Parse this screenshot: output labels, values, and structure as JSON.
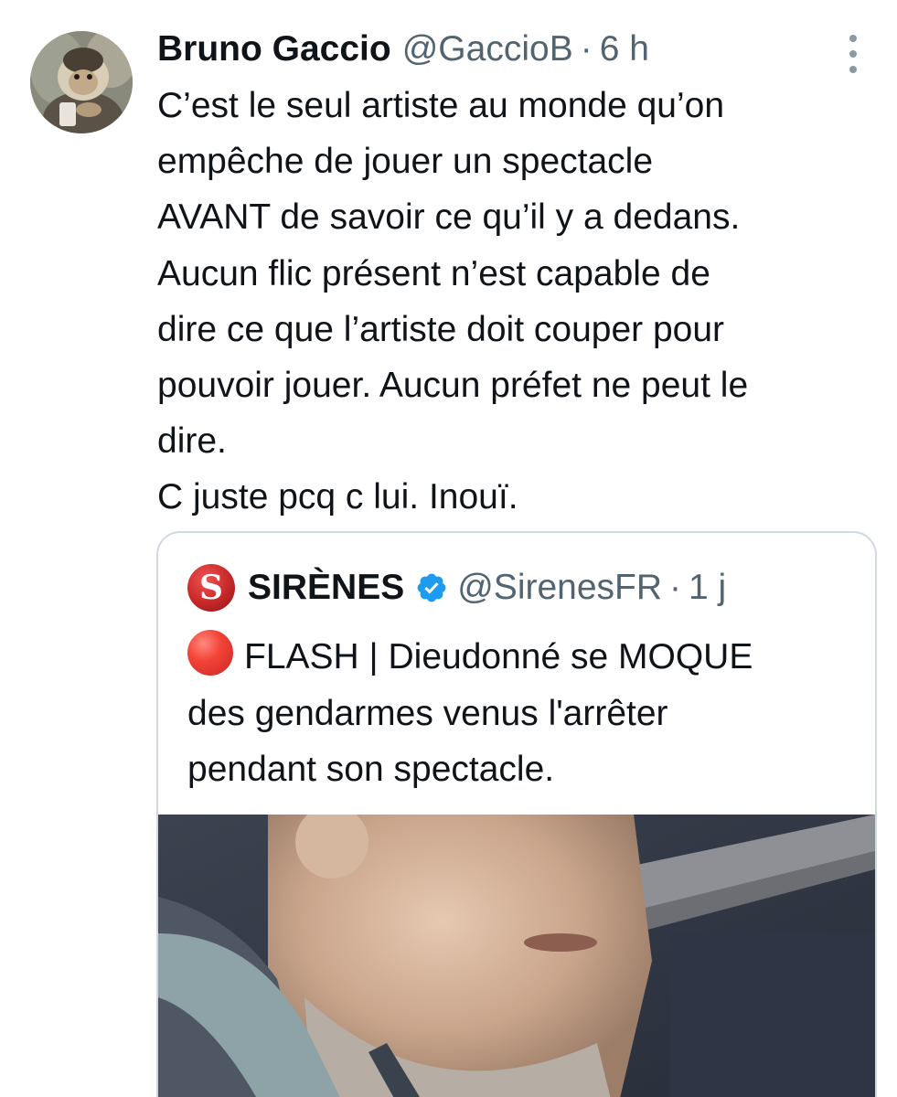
{
  "tweet": {
    "author_name": "Bruno Gaccio",
    "author_handle": "@GaccioB",
    "separator": "·",
    "time": "6 h",
    "avatar_icon": "capuchin-monkey-avatar",
    "more_icon": "more-options-icon",
    "text_lines": [
      "C’est le seul artiste au monde qu’on",
      "empêche de jouer un spectacle",
      "AVANT de savoir ce qu’il y a dedans.",
      "Aucun flic présent n’est capable de",
      "dire ce que l’artiste doit couper pour",
      "pouvoir jouer. Aucun préfet ne peut le",
      "dire.",
      "C juste pcq c lui. Inouï."
    ]
  },
  "quoted_tweet": {
    "logo_letter": "S",
    "logo_color": "#c62828",
    "author_name": "SIRÈNES",
    "verified_icon": "verified-badge-icon",
    "verified_color": "#1d9bf0",
    "author_handle": "@SirenesFR",
    "separator": "·",
    "time": "1 j",
    "emoji_icon": "red-circle-emoji",
    "text_line_1": "FLASH | Dieudonné se MOQUE",
    "text_lines_rest": [
      "des gendarmes venus l'arrêter",
      "pendant son spectacle."
    ],
    "media_icon": "video-thumbnail-man"
  },
  "colors": {
    "primary_text": "#0f1419",
    "secondary_text": "#536471",
    "border": "#cfd9de"
  }
}
